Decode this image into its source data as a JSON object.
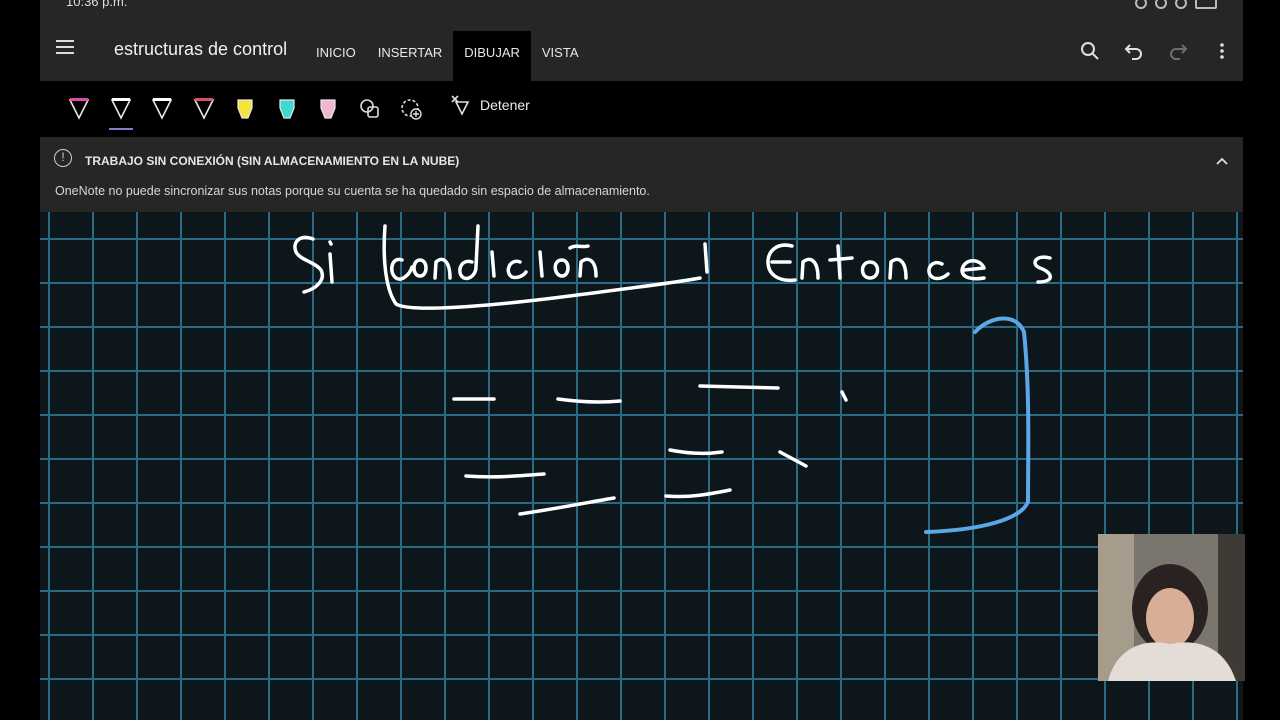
{
  "status": {
    "time": "10:36 p.m."
  },
  "app": {
    "title": "estructuras de control"
  },
  "tabs": [
    {
      "label": "INICIO",
      "active": false
    },
    {
      "label": "INSERTAR",
      "active": false
    },
    {
      "label": "DIBUJAR",
      "active": true
    },
    {
      "label": "VISTA",
      "active": false
    }
  ],
  "toolbar_icons": [
    "search-icon",
    "undo-icon",
    "redo-icon",
    "more-options-icon"
  ],
  "draw_tools": {
    "pens": [
      {
        "icon": "pen-icon",
        "color": "#e04aa0",
        "selected": false
      },
      {
        "icon": "pen-icon",
        "color": "#ffffff",
        "selected": true
      },
      {
        "icon": "pen-icon",
        "color": "#ffffff",
        "selected": false
      },
      {
        "icon": "pen-icon",
        "color": "#e05060",
        "selected": false
      },
      {
        "icon": "highlighter-icon",
        "color": "#f5e43a",
        "selected": false
      },
      {
        "icon": "highlighter-icon",
        "color": "#3fd8d0",
        "selected": false
      },
      {
        "icon": "highlighter-icon",
        "color": "#f0b8d0",
        "selected": false
      },
      {
        "icon": "shapes-icon",
        "color": "#dddddd",
        "selected": false
      },
      {
        "icon": "lasso-select-icon",
        "color": "#dddddd",
        "selected": false
      }
    ],
    "stop_label": "Detener"
  },
  "banner": {
    "title": "TRABAJO SIN CONEXIÓN (SIN ALMACENAMIENTO EN LA NUBE)",
    "message": "OneNote no puede sincronizar sus notas porque su cuenta se ha quedado sin espacio de almacenamiento."
  },
  "colors": {
    "ink": "#ffffff",
    "bracket_ink": "#5aa8e6",
    "grid": "#2a6a84",
    "canvas": "#0c161b"
  }
}
